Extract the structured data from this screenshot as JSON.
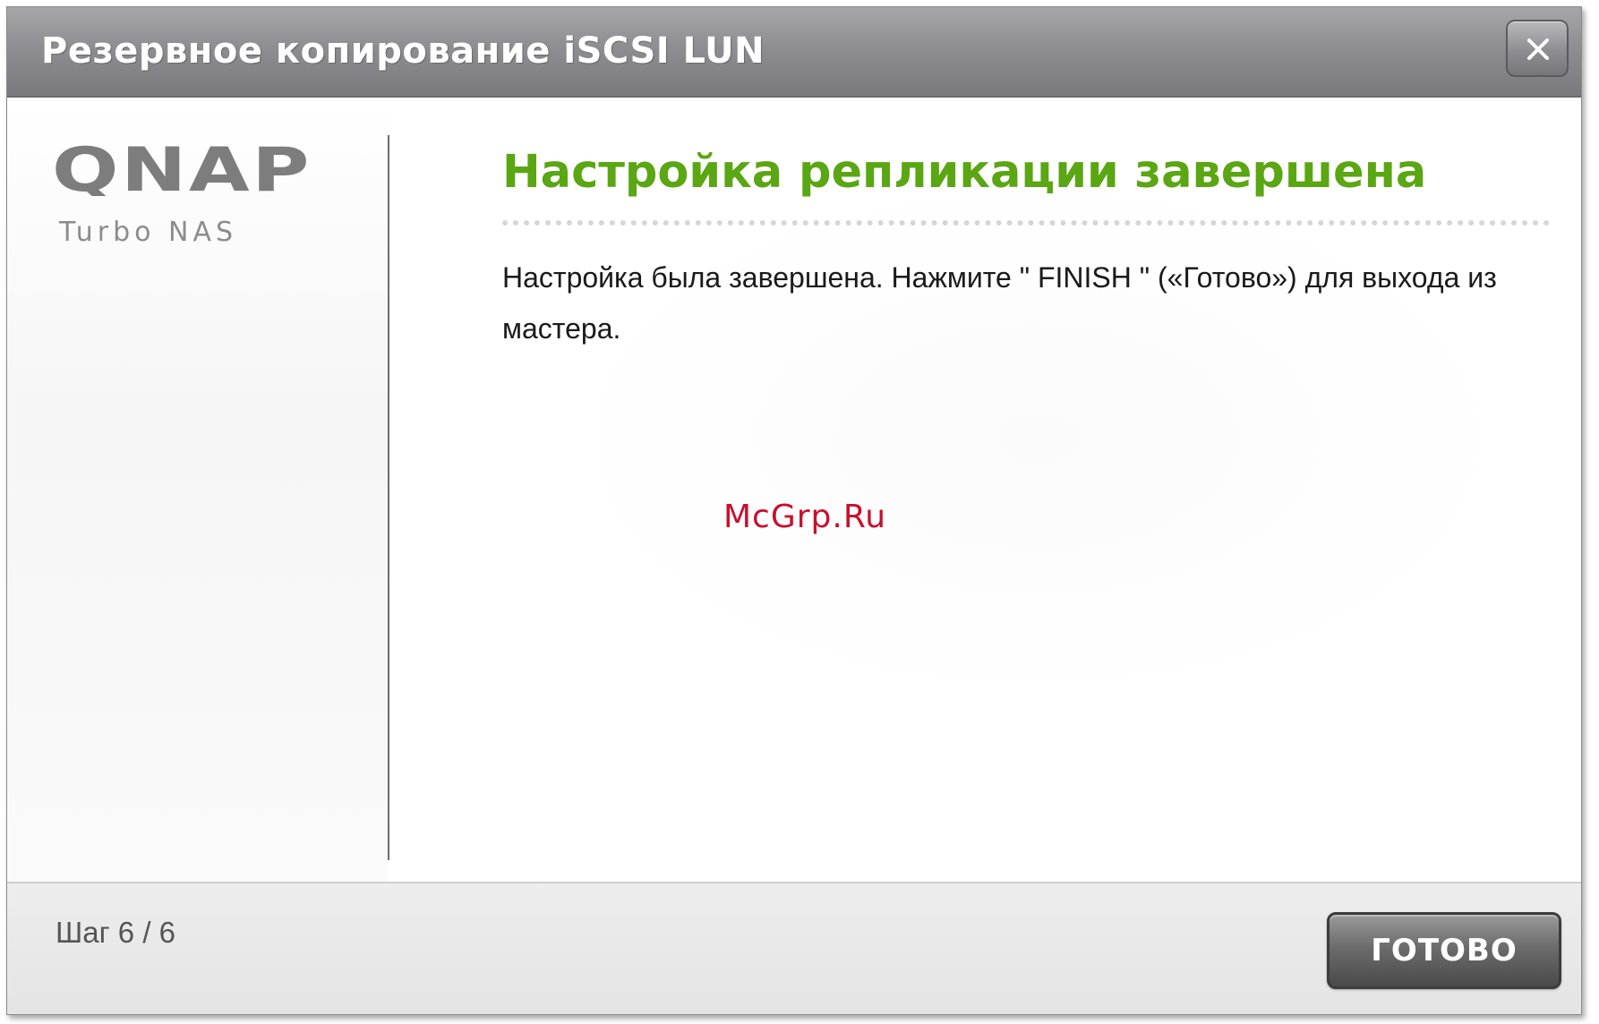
{
  "window": {
    "title": "Резервное копирование iSCSI LUN",
    "close_label": "X"
  },
  "sidebar": {
    "logo_text": "QNAP",
    "logo_subtitle": "Turbo NAS"
  },
  "content": {
    "heading": "Настройка репликации завершена",
    "message": "Настройка была завершена. Нажмите \" FINISH \" («Готово») для выхода из мастера."
  },
  "watermark": "McGrp.Ru",
  "footer": {
    "step": "Шаг 6 / 6",
    "finish_button": "ГОТОВО"
  },
  "colors": {
    "heading": "#5aa613",
    "titlebar": "#8e8e92",
    "watermark": "#c8102e",
    "button": "#5a5a5a"
  }
}
